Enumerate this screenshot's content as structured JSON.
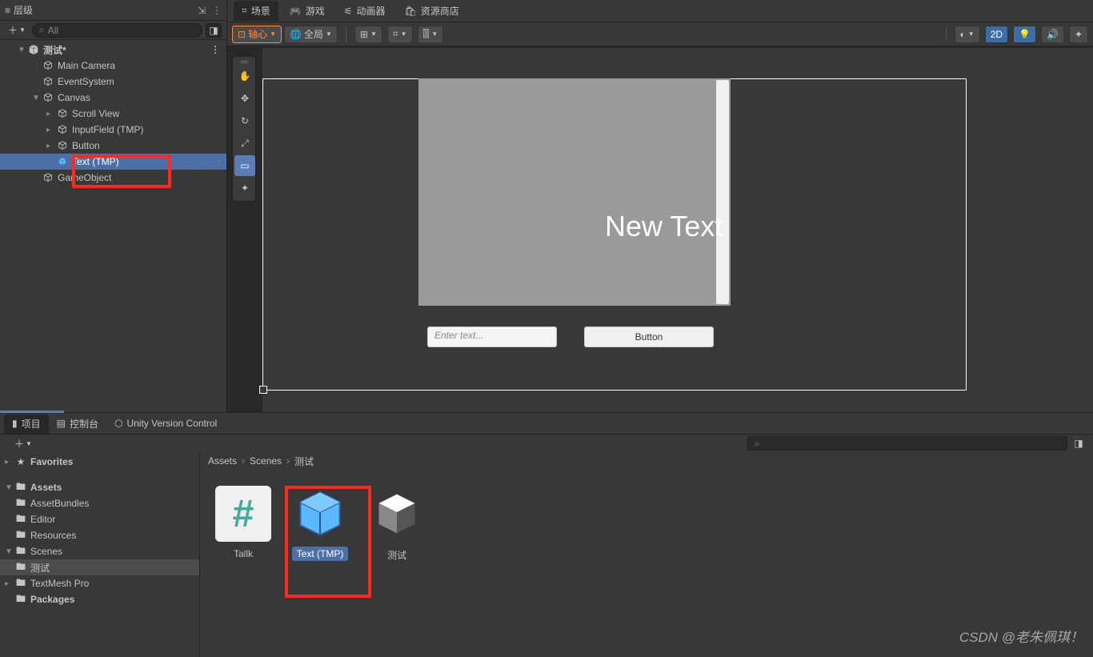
{
  "hierarchy": {
    "title": "层级",
    "search_placeholder": "All",
    "scene_name": "测试*",
    "items": [
      {
        "label": "Main Camera"
      },
      {
        "label": "EventSystem"
      },
      {
        "label": "Canvas"
      },
      {
        "label": "Scroll View"
      },
      {
        "label": "InputField (TMP)"
      },
      {
        "label": "Button"
      },
      {
        "label": "Text (TMP)"
      },
      {
        "label": "GameObject"
      }
    ]
  },
  "scene": {
    "tabs": [
      {
        "label": "场景"
      },
      {
        "label": "游戏"
      },
      {
        "label": "动画器"
      },
      {
        "label": "资源商店"
      }
    ],
    "toolbar": {
      "pivot": "轴心",
      "global": "全局",
      "mode2d": "2D"
    },
    "ui": {
      "text": "New Text",
      "input_placeholder": "Enter text...",
      "button_label": "Button"
    }
  },
  "project": {
    "tabs": [
      {
        "label": "项目"
      },
      {
        "label": "控制台"
      },
      {
        "label": "Unity Version Control"
      }
    ],
    "folders": {
      "favorites": "Favorites",
      "assets": "Assets",
      "children": [
        {
          "label": "AssetBundles"
        },
        {
          "label": "Editor"
        },
        {
          "label": "Resources"
        },
        {
          "label": "Scenes"
        },
        {
          "label": "测试"
        },
        {
          "label": "TextMesh Pro"
        }
      ],
      "packages": "Packages"
    },
    "breadcrumb": [
      "Assets",
      "Scenes",
      "测试"
    ],
    "assets": [
      {
        "name": "Tallk",
        "type": "script"
      },
      {
        "name": "Text (TMP)",
        "type": "prefab",
        "selected": true
      },
      {
        "name": "测试",
        "type": "scene"
      }
    ]
  },
  "watermark": "CSDN @老朱佩琪！"
}
